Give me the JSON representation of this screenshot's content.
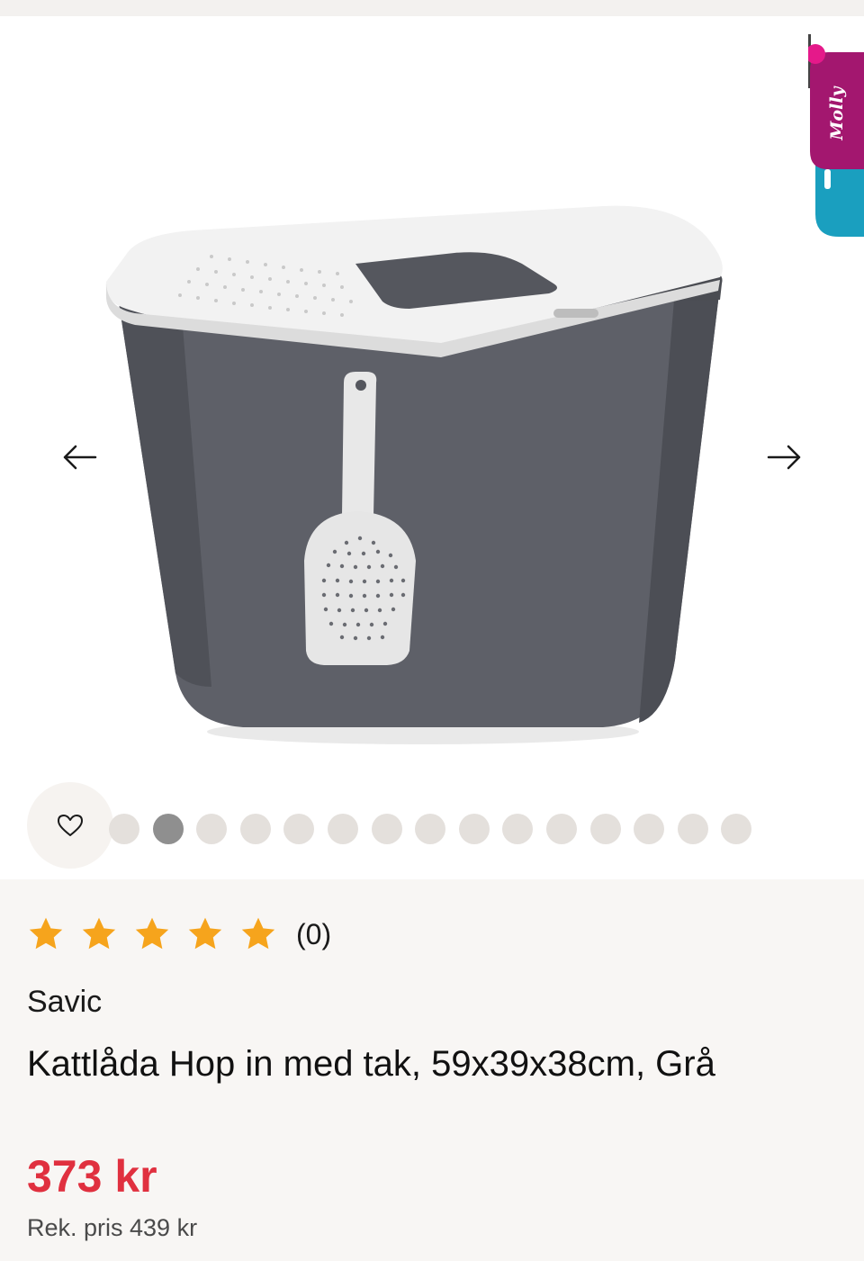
{
  "gallery": {
    "images_total": 15,
    "active_index": 1,
    "badge_text": "Molly",
    "icons": {
      "prev": "arrow-left-icon",
      "next": "arrow-right-icon",
      "favorite": "heart-icon"
    }
  },
  "product": {
    "rating": {
      "value": 0,
      "max": 5,
      "count_label": "(0)"
    },
    "brand": "Savic",
    "title": "Kattlåda Hop in med tak, 59x39x38cm, Grå",
    "price": "373 kr",
    "recommended_price": "Rek. pris 439 kr"
  },
  "colors": {
    "price": "#e0303f",
    "star": "#f6a41c",
    "dot_active": "#8f8f8f",
    "dot_inactive": "#e4e0dc",
    "badge_magenta": "#a3176f",
    "badge_teal": "#1a9fbf"
  }
}
